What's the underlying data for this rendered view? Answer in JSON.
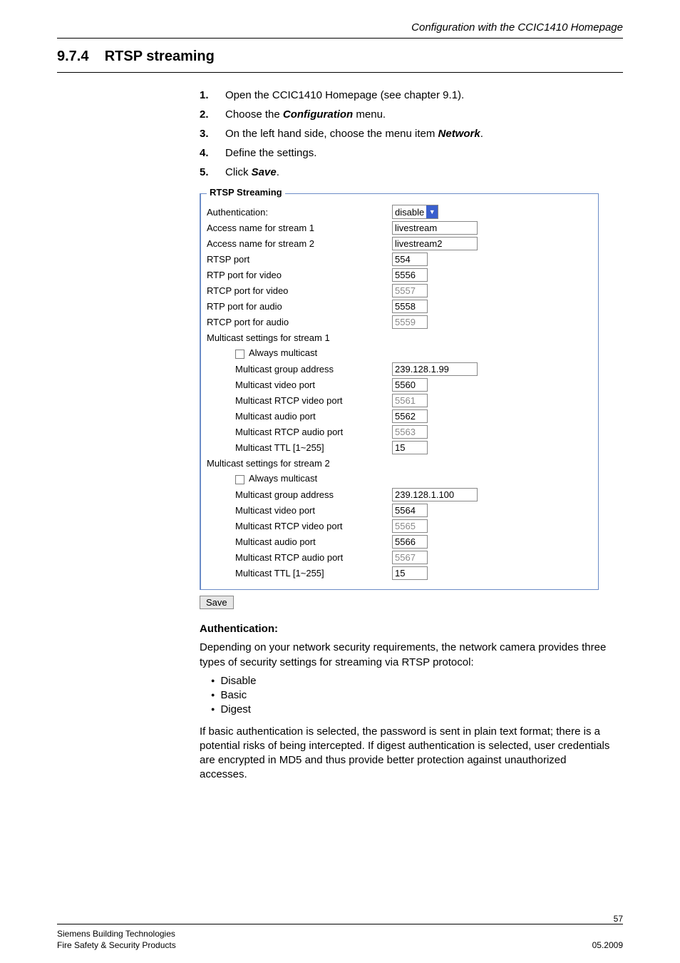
{
  "header": {
    "breadcrumb": "Configuration with the CCIC1410 Homepage"
  },
  "section": {
    "number": "9.7.4",
    "title": "RTSP streaming"
  },
  "steps": [
    {
      "num": "1.",
      "prefix": "Open the CCIC1410 Homepage (see chapter 9.1)."
    },
    {
      "num": "2.",
      "prefix": "Choose the ",
      "bold": "Configuration",
      "suffix": " menu."
    },
    {
      "num": "3.",
      "prefix": "On the left hand side, choose the menu item ",
      "bold": "Network",
      "suffix": "."
    },
    {
      "num": "4.",
      "prefix": "Define the settings."
    },
    {
      "num": "5.",
      "prefix": "Click ",
      "bold": "Save",
      "suffix": "."
    }
  ],
  "rtsp": {
    "legend": "RTSP Streaming",
    "labels": {
      "auth": "Authentication:",
      "access1": "Access name for stream 1",
      "access2": "Access name for stream 2",
      "rtsp_port": "RTSP port",
      "rtp_video": "RTP port for video",
      "rtcp_video": "RTCP port for video",
      "rtp_audio": "RTP port for audio",
      "rtcp_audio": "RTCP port for audio",
      "m1_title": "Multicast settings for stream 1",
      "always": "Always multicast",
      "mc_group": "Multicast group address",
      "mc_vport": "Multicast video port",
      "mc_rtcp_v": "Multicast RTCP video port",
      "mc_aport": "Multicast audio port",
      "mc_rtcp_a": "Multicast RTCP audio port",
      "mc_ttl": "Multicast TTL [1~255]",
      "m2_title": "Multicast settings for stream 2"
    },
    "values": {
      "auth": "disable",
      "access1": "livestream",
      "access2": "livestream2",
      "rtsp_port": "554",
      "rtp_video": "5556",
      "rtcp_video": "5557",
      "rtp_audio": "5558",
      "rtcp_audio": "5559",
      "s1": {
        "group": "239.128.1.99",
        "vport": "5560",
        "rtcp_v": "5561",
        "aport": "5562",
        "rtcp_a": "5563",
        "ttl": "15"
      },
      "s2": {
        "group": "239.128.1.100",
        "vport": "5564",
        "rtcp_v": "5565",
        "aport": "5566",
        "rtcp_a": "5567",
        "ttl": "15"
      }
    },
    "save_label": "Save"
  },
  "body": {
    "sub": "Authentication:",
    "p1": "Depending on your network security requirements, the network camera provides three types of security settings for streaming via RTSP protocol:",
    "bullets": [
      "Disable",
      "Basic",
      "Digest"
    ],
    "p2": "If basic authentication is selected, the password is sent in plain text format; there is a potential risks of being intercepted. If digest authentication is selected, user credentials are encrypted in MD5 and thus provide better protection against unauthorized accesses."
  },
  "footer": {
    "page": "57",
    "l1": "Siemens Building Technologies",
    "l2": "Fire Safety & Security Products",
    "date": "05.2009"
  }
}
